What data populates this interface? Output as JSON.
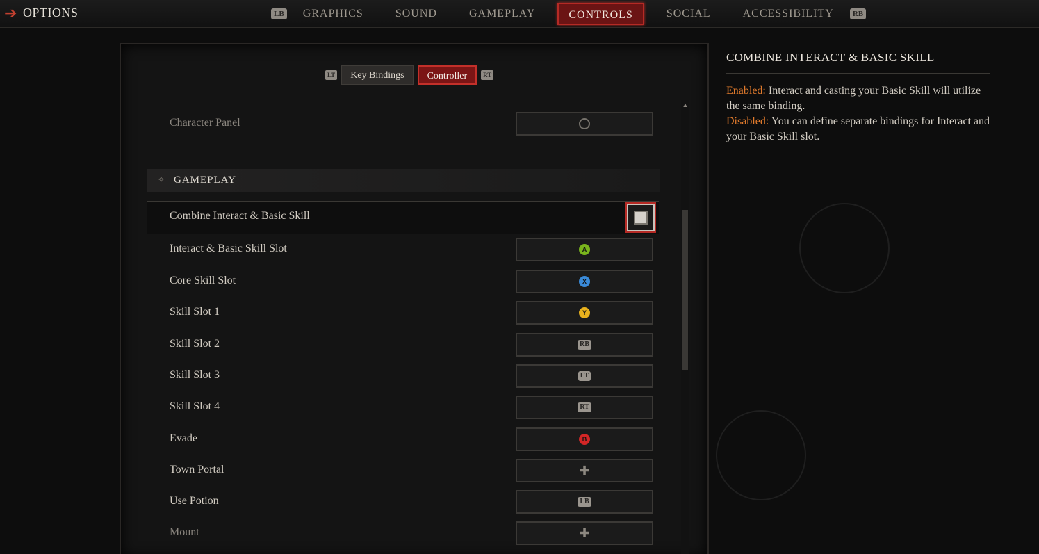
{
  "topbar": {
    "title": "OPTIONS",
    "lb": "LB",
    "rb": "RB",
    "tabs": [
      "GRAPHICS",
      "SOUND",
      "GAMEPLAY",
      "CONTROLS",
      "SOCIAL",
      "ACCESSIBILITY"
    ],
    "active_tab": "CONTROLS"
  },
  "subtabs": {
    "lt": "LT",
    "rt": "RT",
    "items": [
      "Key Bindings",
      "Controller"
    ],
    "active": "Controller"
  },
  "prev_row": {
    "label": "Character Panel"
  },
  "section": {
    "title": "GAMEPLAY"
  },
  "combine": {
    "label": "Combine Interact & Basic Skill",
    "checked": false
  },
  "bindings": [
    {
      "label": "Interact & Basic Skill Slot",
      "button": "A",
      "kind": "circle",
      "color": "#7ab51d"
    },
    {
      "label": "Core Skill Slot",
      "button": "X",
      "kind": "circle",
      "color": "#3a8ad8"
    },
    {
      "label": "Skill Slot 1",
      "button": "Y",
      "kind": "circle",
      "color": "#e9b21d"
    },
    {
      "label": "Skill Slot 2",
      "button": "RB",
      "kind": "rect"
    },
    {
      "label": "Skill Slot 3",
      "button": "LT",
      "kind": "rect"
    },
    {
      "label": "Skill Slot 4",
      "button": "RT",
      "kind": "rect"
    },
    {
      "label": "Evade",
      "button": "B",
      "kind": "circle",
      "color": "#d32626"
    },
    {
      "label": "Town Portal",
      "button": "dpad",
      "kind": "dpad"
    },
    {
      "label": "Use Potion",
      "button": "LB",
      "kind": "rect"
    },
    {
      "label": "Mount",
      "button": "dpad",
      "kind": "dpad"
    }
  ],
  "description": {
    "title": "COMBINE INTERACT & BASIC SKILL",
    "enabled_label": "Enabled:",
    "enabled_text": " Interact and casting your Basic Skill will utilize the same binding.",
    "disabled_label": "Disabled:",
    "disabled_text": " You can define separate bindings for Interact and your Basic Skill slot."
  },
  "colors": {
    "accent_red": "#b52a25",
    "highlight_orange": "#e07a2c"
  }
}
